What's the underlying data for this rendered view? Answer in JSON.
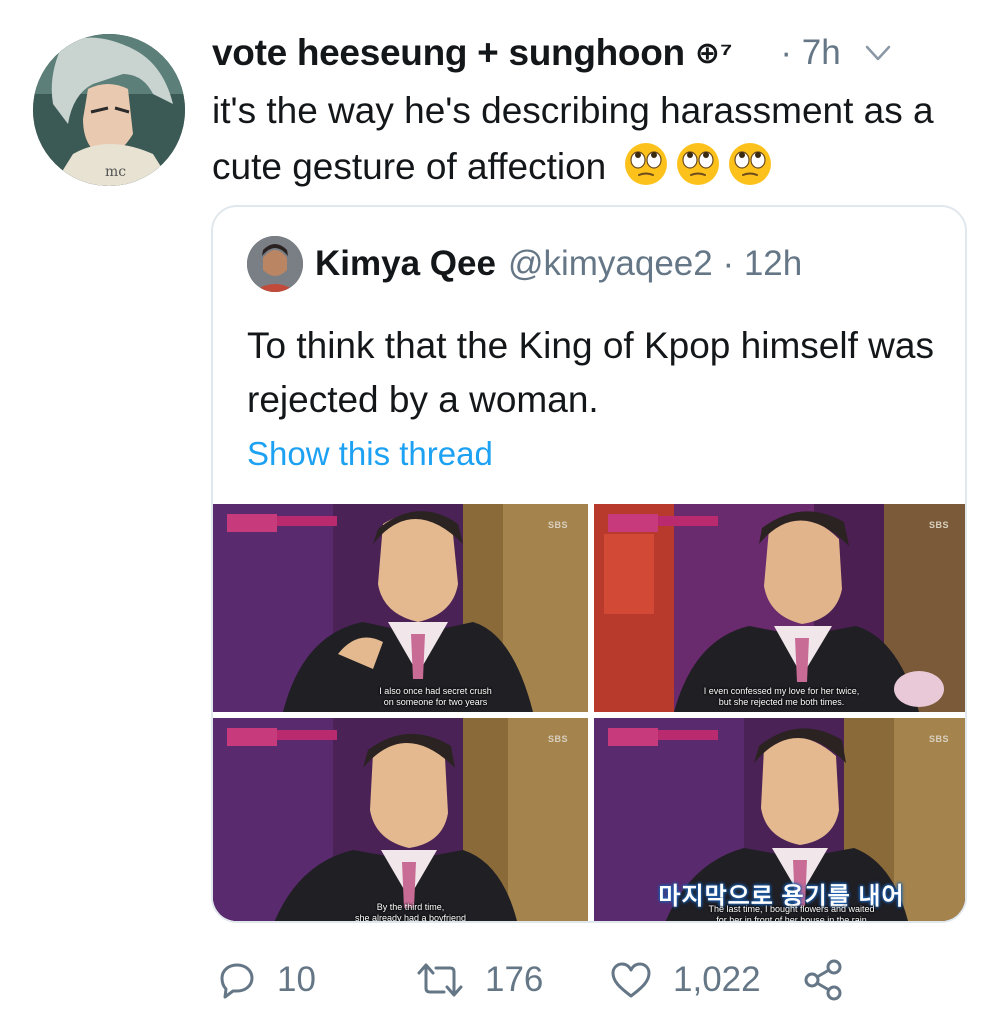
{
  "tweet": {
    "author_name": "vote heeseung + sunghoon",
    "author_emoji": "⊕⁷",
    "time": "· 7h",
    "text": "it's the way he's describing harassment as a cute gesture of affection",
    "emoji": "face-with-rolling-eyes"
  },
  "quote": {
    "name": "Kimya Qee",
    "handle": "@kimyaqee2 · 12h",
    "text": "To think that the King of Kpop himself was rejected by a woman.",
    "show_thread": "Show this thread",
    "images": [
      {
        "subtitle_line1": "I also once had secret crush",
        "subtitle_line2": "on someone for two years",
        "channel": "SBS"
      },
      {
        "subtitle_line1": "I even confessed my love for her twice,",
        "subtitle_line2": "but she rejected me both times.",
        "channel": "SBS"
      },
      {
        "subtitle_line1": "By the third time,",
        "subtitle_line2": "she already had a boyfriend",
        "channel": "SBS"
      },
      {
        "subtitle_line1": "The last time, I bought flowers and waited",
        "subtitle_line2": "for her in front of her house in the rain",
        "channel": "SBS",
        "korean_caption": "마지막으로 용기를 내어"
      }
    ]
  },
  "actions": {
    "replies": "10",
    "retweets": "176",
    "likes": "1,022"
  },
  "colors": {
    "text": "#14171a",
    "secondary": "#657786",
    "link": "#1da1f2",
    "border": "#e1e8ed"
  }
}
